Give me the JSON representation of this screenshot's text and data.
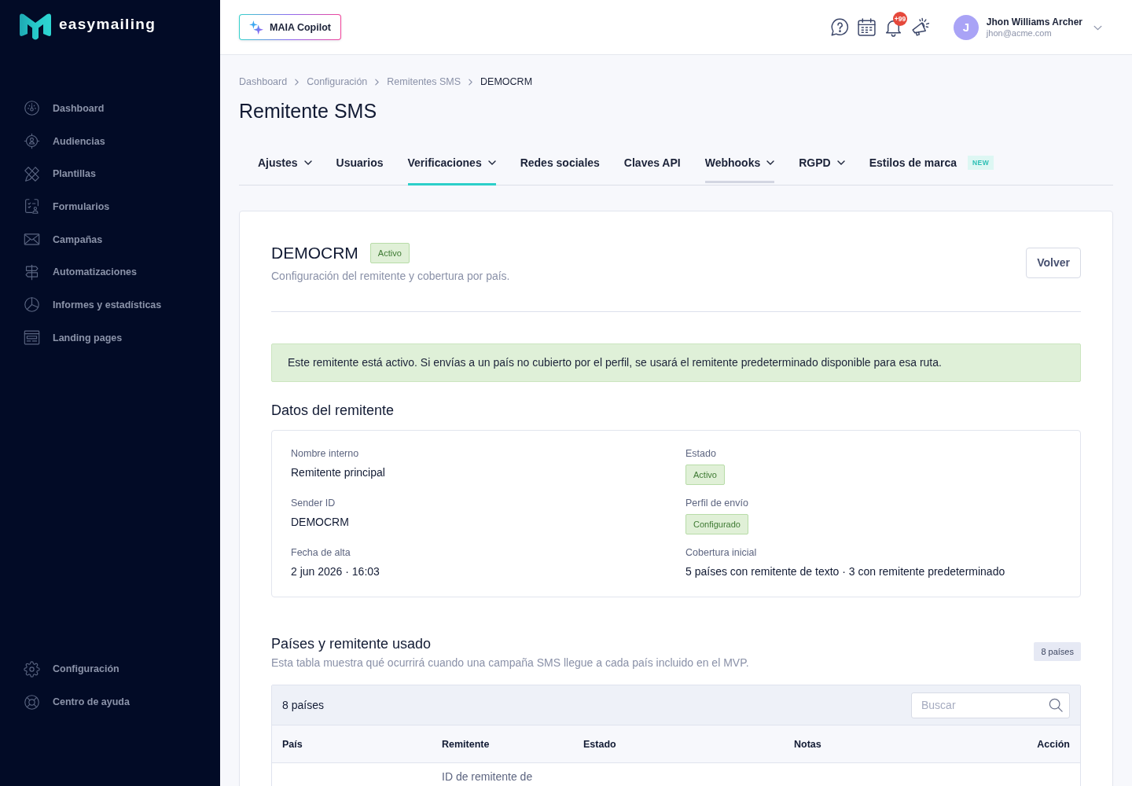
{
  "sidebar": {
    "logo": "easymailing",
    "items": [
      {
        "label": "Dashboard",
        "selected": false
      },
      {
        "label": "Audiencias",
        "selected": false
      },
      {
        "label": "Plantillas",
        "selected": false
      },
      {
        "label": "Formularios",
        "selected": false
      },
      {
        "label": "Campañas",
        "selected": false
      },
      {
        "label": "Automatizaciones",
        "selected": false
      },
      {
        "label": "Informes y estadísticas",
        "selected": false
      },
      {
        "label": "Landing pages",
        "selected": false
      }
    ],
    "footer_items": [
      {
        "label": "Configuración",
        "selected": false
      },
      {
        "label": "Centro de ayuda",
        "selected": false
      }
    ]
  },
  "header": {
    "copilot_button": "MAIA Copilot",
    "notification_count": "+99",
    "user": {
      "initial": "J",
      "name": "Jhon Williams Archer",
      "email": "jhon@acme.com"
    }
  },
  "breadcrumb": [
    {
      "label": "Dashboard",
      "current": false
    },
    {
      "label": "Configuración",
      "current": false
    },
    {
      "label": "Remitentes SMS",
      "current": false
    },
    {
      "label": "DEMOCRM",
      "current": true
    }
  ],
  "title": "Remitente SMS",
  "tabs": [
    {
      "label": "Ajustes",
      "dropdown": true,
      "selected": false,
      "hovered": false
    },
    {
      "label": "Usuarios",
      "dropdown": false,
      "selected": false,
      "hovered": false
    },
    {
      "label": "Verificaciones",
      "dropdown": true,
      "selected": true,
      "hovered": false
    },
    {
      "label": "Redes sociales",
      "dropdown": false,
      "selected": false,
      "hovered": false
    },
    {
      "label": "Claves API",
      "dropdown": false,
      "selected": false,
      "hovered": false
    },
    {
      "label": "Webhooks",
      "dropdown": true,
      "selected": false,
      "hovered": true
    },
    {
      "label": "RGPD",
      "dropdown": true,
      "selected": false,
      "hovered": false
    },
    {
      "label": "Estilos de marca",
      "dropdown": false,
      "selected": false,
      "hovered": false,
      "badge": "NEW"
    }
  ],
  "sender": {
    "name": "DEMOCRM",
    "status": "Activo",
    "subtitle": "Configuración del remitente y cobertura por país.",
    "back_button": "Volver",
    "alert": "Este remitente está activo. Si envías a un país no cubierto por el perfil, se usará el remitente predeterminado disponible para esa ruta.",
    "details_title": "Datos del remitente",
    "fields": [
      {
        "label": "Nombre interno",
        "value": "Remitente principal",
        "kind": "text"
      },
      {
        "label": "Estado",
        "value": "Activo",
        "kind": "badge"
      },
      {
        "label": "Sender ID",
        "value": "DEMOCRM",
        "kind": "text"
      },
      {
        "label": "Perfil de envío",
        "value": "Configurado",
        "kind": "badge"
      },
      {
        "label": "Fecha de alta",
        "value": "2 jun 2026 · 16:03",
        "kind": "text"
      },
      {
        "label": "Cobertura inicial",
        "value": "5 países con remitente de texto · 3 con remitente predeterminado",
        "kind": "text"
      }
    ]
  },
  "countries": {
    "title": "Países y remitente usado",
    "subtitle": "Esta tabla muestra qué ocurrirá cuando una campaña SMS llegue a cada país incluido en el MVP.",
    "count_badge": "8 países",
    "table": {
      "count": "8 países",
      "search": {
        "placeholder": "Buscar"
      },
      "columns": [
        "País",
        "Remitente",
        "Estado",
        "Notas",
        "Acción"
      ],
      "rows": [
        {
          "remitente": "ID de remitente de"
        }
      ]
    }
  }
}
